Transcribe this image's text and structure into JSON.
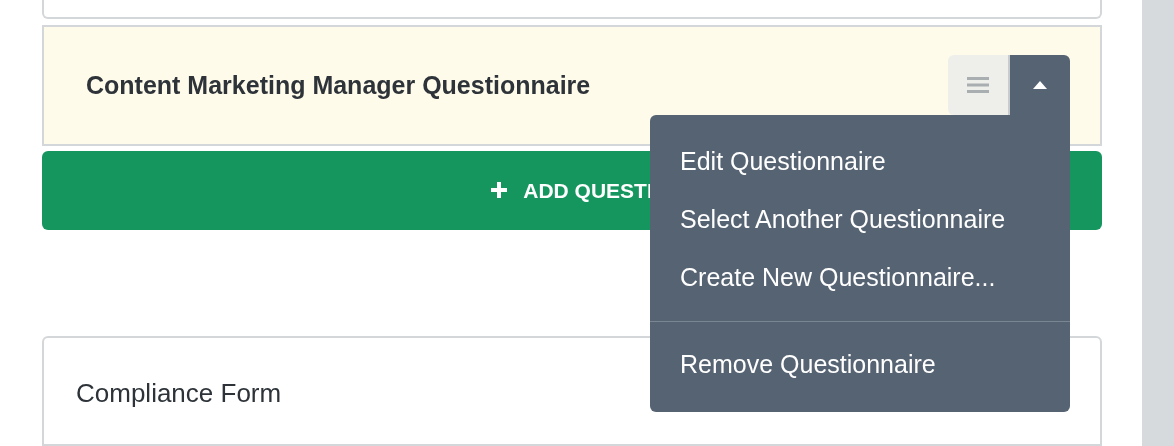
{
  "questionnaire_card": {
    "title": "Content Marketing Manager Questionnaire",
    "menu_open": true
  },
  "menu": {
    "items": [
      {
        "label": "Edit Questionnaire",
        "kind": "item"
      },
      {
        "label": "Select Another Questionnaire",
        "kind": "item"
      },
      {
        "label": "Create New Questionnaire...",
        "kind": "item"
      },
      {
        "kind": "divider"
      },
      {
        "label": "Remove Questionnaire",
        "kind": "item"
      }
    ]
  },
  "add_button": {
    "label": "ADD QUESTI"
  },
  "compliance_card": {
    "title": "Compliance Form"
  }
}
